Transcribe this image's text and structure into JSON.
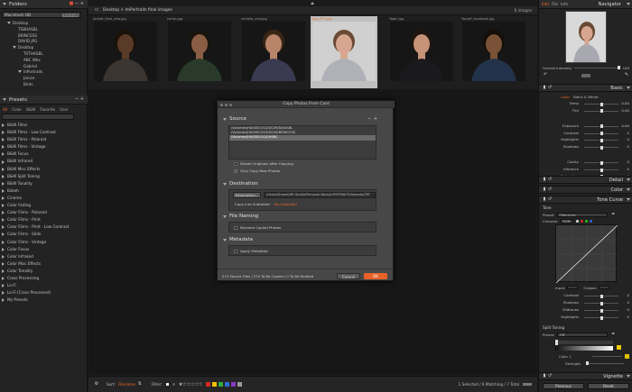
{
  "folders_panel": {
    "title": "Folders",
    "drive": "Macintosh HD",
    "drive_badge": "500.0 GB",
    "tree": [
      "Desktop",
      "TSBHASBL",
      "BRINCESS",
      "DAVID JPG",
      "Desktop",
      "TSTHASBL",
      "ABC Wks",
      "Gabriel",
      "InPortraits",
      "Janice",
      "Birds"
    ]
  },
  "presets_panel": {
    "title": "Presets",
    "tabs": [
      "All",
      "Color",
      "B&W",
      "Favorite",
      "User"
    ],
    "items": [
      "B&W Films",
      "B&W Films - Low Contrast",
      "B&W Films - Polaroid",
      "B&W Films - Vintage",
      "B&W Focus",
      "B&W Infrared",
      "B&W Misc Effects",
      "B&W Split Toning",
      "B&W Tonality",
      "Bokeh",
      "Cinema",
      "Color Fading",
      "Color Films - Polaroid",
      "Color Films - Print",
      "Color Films - Print - Low Contrast",
      "Color Films - Slide",
      "Color Films - Vintage",
      "Color Focus",
      "Color Infrared",
      "Color Misc Effects",
      "Color Tonality",
      "Cross Processing",
      "Lo-Fi",
      "Lo-Fi (Cross Processed)",
      "My Presets"
    ]
  },
  "browser": {
    "path": "Desktop > ImPortraits final images",
    "count": "6 images",
    "thumbnails": [
      {
        "name": "ahmat_final_new.jpg",
        "skin": "#5a3a28",
        "hair": "#1a1208",
        "shirt": "#3a3530"
      },
      {
        "name": "carlos.jpg",
        "skin": "#8a5e44",
        "hair": "#1a140e",
        "shirt": "#2a3a2a"
      },
      {
        "name": "nehalia_new.jpg",
        "skin": "#b8846a",
        "hair": "#3a2616",
        "shirt": "#3a3a52"
      },
      {
        "name": "olga_PT1.jpg",
        "skin": "#d8a690",
        "hair": "#6a4a34",
        "shirt": "#b0b0b8"
      },
      {
        "name": "Yaghi.jpg",
        "skin": "#c69278",
        "hair": "#1e1610",
        "shirt": "#1a1a1e"
      },
      {
        "name": "Yousef_facebook.jpg",
        "skin": "#7a5238",
        "hair": "#160e08",
        "shirt": "#22324a"
      }
    ],
    "selected_index": 3
  },
  "dialog": {
    "title": "Copy Photos From Card",
    "source": {
      "heading": "Source",
      "paths": [
        "/Volumes/HASSELOG4/DCIM/DJ4ASBL",
        "/Volumes/HASSELOG4/DCIM/BRINCESS",
        "/Volumes/HASSELOG4/HSBL"
      ],
      "selected_path": 2,
      "delete_label": "Delete Originals after Copying",
      "delete_checked": false,
      "only_new_label": "Only Copy New Photos",
      "only_new_checked": true
    },
    "destination": {
      "heading": "Destination",
      "button": "Destination...",
      "path": "/Users/Shared/HR Studio/Personal Work/InPORTRAITS/Imports/TRT",
      "subfolder_label": "Copy Into Subfolder:",
      "subfolder_value": "No Subfolder"
    },
    "naming": {
      "heading": "File Naming",
      "rename_label": "Rename Copied Photos"
    },
    "metadata": {
      "heading": "Metadata",
      "apply_label": "Apply Metadata"
    },
    "status": "274 Source Files / 274 To Be Copied / 0 To Be Deleted",
    "cancel": "Cancel",
    "ok": "OK"
  },
  "bottombar": {
    "sort_label": "Sort:",
    "sort_value": "Filename",
    "filter_label": "Filter:",
    "status": "1 Selected / 6 Matching / 7 Total",
    "color_swatches": [
      "#d52b1e",
      "#f3c300",
      "#2fae3c",
      "#2e6bd6",
      "#8a3ac6",
      "#9a9a9a"
    ]
  },
  "right_panel": {
    "navigator_title": "Navigator",
    "top_tabs": [
      "Edit",
      "File",
      "Info"
    ],
    "overall_intensity_label": "Overall Intensity",
    "overall_intensity_value": "100",
    "basic": {
      "title": "Basic",
      "mode_tabs": [
        "Color",
        "Black & White"
      ],
      "sliders": [
        {
          "label": "Temp",
          "value": "0.00",
          "pos": 0.5
        },
        {
          "label": "Tint",
          "value": "0.00",
          "pos": 0.5
        },
        {
          "label": "Exposure",
          "value": "0.00",
          "pos": 0.5
        },
        {
          "label": "Contrast",
          "value": "0",
          "pos": 0.5
        },
        {
          "label": "Highlights",
          "value": "0",
          "pos": 0.5
        },
        {
          "label": "Shadows",
          "value": "0",
          "pos": 0.5
        },
        {
          "label": "Clarity",
          "value": "0",
          "pos": 0.5
        },
        {
          "label": "Vibrance",
          "value": "0",
          "pos": 0.5
        },
        {
          "label": "Saturation",
          "value": "0",
          "pos": 0.5
        }
      ]
    },
    "detail_title": "Detail",
    "color_title": "Color",
    "tone_curve": {
      "title": "Tone Curve",
      "tone_label": "Tone",
      "preset_label": "Preset:",
      "preset_value": "Flatcurve",
      "channel_label": "Channel:",
      "channel_value": "RGB",
      "input_label": "Input:",
      "output_label": "Output:",
      "sliders": [
        {
          "label": "Contrast",
          "value": "0",
          "pos": 0.5
        },
        {
          "label": "Shadows",
          "value": "0",
          "pos": 0.5
        },
        {
          "label": "Midtones",
          "value": "0",
          "pos": 0.5
        },
        {
          "label": "Highlights",
          "value": "0",
          "pos": 0.5
        }
      ]
    },
    "split_toning": {
      "title": "Split Toning",
      "preset_label": "Preset:",
      "preset_value": "Off",
      "color1_label": "Color 1",
      "strength_label": "Strength",
      "color1_swatch": "#e0c000",
      "color2_swatch": "#f0c800"
    },
    "vignette_title": "Vignette",
    "previous": "Previous",
    "reset": "Reset"
  },
  "colors": {
    "accent": "#f06a2c",
    "ok_button": "#e8622a"
  }
}
